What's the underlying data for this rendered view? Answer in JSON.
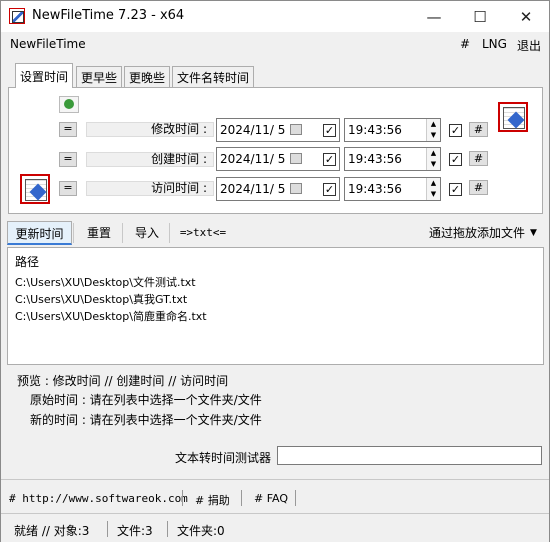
{
  "window": {
    "title": "NewFileTime 7.23 - x64",
    "controls": {
      "minimize": "—",
      "maximize": "☐",
      "close": "✕"
    }
  },
  "menubar": {
    "app_name": "NewFileTime",
    "hash": "#",
    "lng": "LNG",
    "exit": "退出"
  },
  "tabs": [
    {
      "label": "设置时间"
    },
    {
      "label": "更早些"
    },
    {
      "label": "更晚些"
    },
    {
      "label": "文件名转时间"
    }
  ],
  "time_rows": [
    {
      "eq": "=",
      "label": "修改时间 :",
      "date": "2024/11/  5",
      "time": "19:43:56",
      "hash": "#"
    },
    {
      "eq": "=",
      "label": "创建时间 :",
      "date": "2024/11/  5",
      "time": "19:43:56",
      "hash": "#"
    },
    {
      "eq": "=",
      "label": "访问时间 :",
      "date": "2024/11/  5",
      "time": "19:43:56",
      "hash": "#"
    }
  ],
  "toolbar": {
    "update": "更新时间",
    "reset": "重置",
    "import": "导入",
    "txt": "=>txt<=",
    "drag_add": "通过拖放添加文件"
  },
  "list": {
    "header": "路径",
    "rows": [
      "C:\\Users\\XU\\Desktop\\文件测试.txt",
      "C:\\Users\\XU\\Desktop\\真我GT.txt",
      "C:\\Users\\XU\\Desktop\\简鹿重命名.txt"
    ]
  },
  "preview": {
    "line": "预览 :   修改时间    //    创建时间    //    访问时间",
    "original": "原始时间 : 请在列表中选择一个文件夹/文件",
    "new": "新的时间 : 请在列表中选择一个文件夹/文件"
  },
  "tester": {
    "label": "文本转时间测试器",
    "value": ""
  },
  "footer_links": [
    {
      "label": "# http://www.softwareok.com"
    },
    {
      "label": "# 捐助"
    },
    {
      "label": "# FAQ"
    }
  ],
  "status": {
    "ready": "就绪 // 对象:3",
    "files": "文件:3",
    "folders": "文件夹:0"
  }
}
